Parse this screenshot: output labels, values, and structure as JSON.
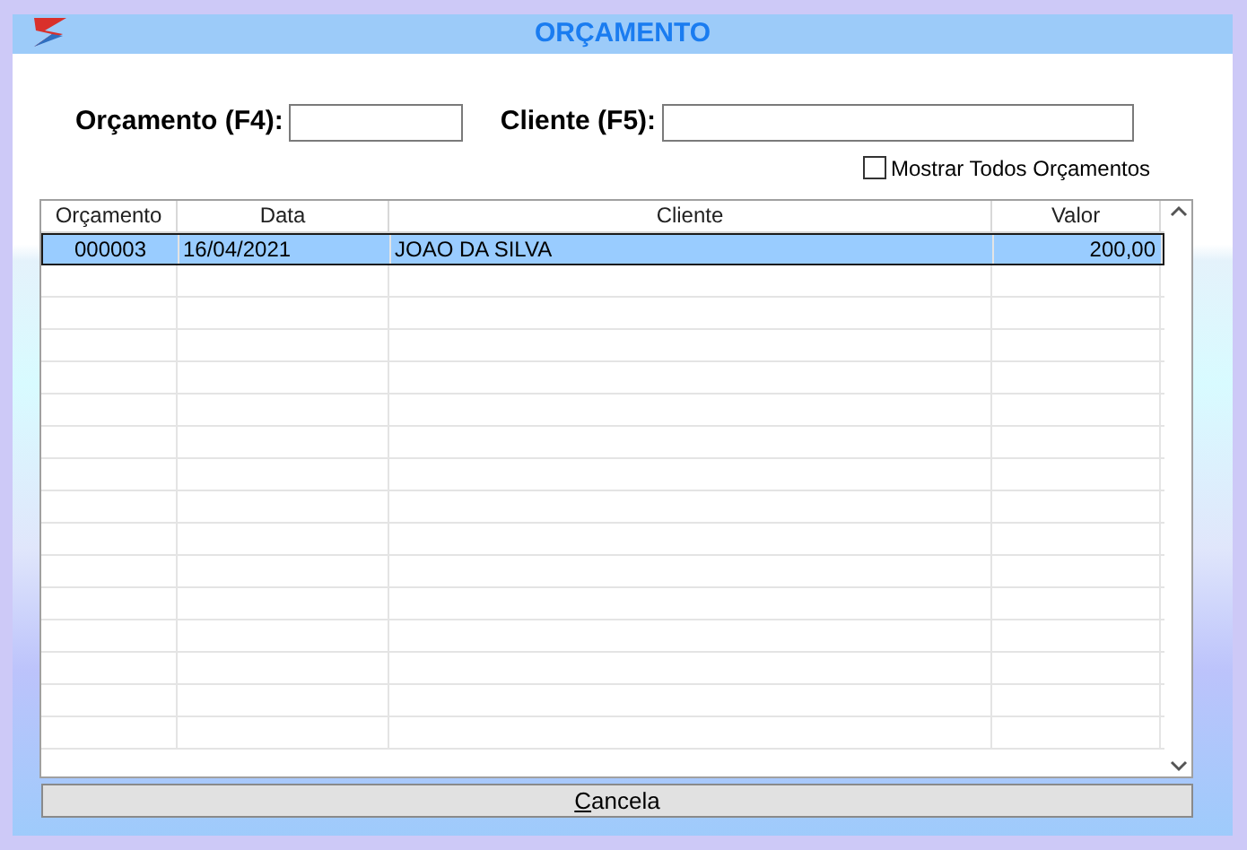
{
  "window": {
    "title": "ORÇAMENTO"
  },
  "filters": {
    "orcamento": {
      "label": "Orçamento (F4):"
    },
    "cliente": {
      "label": "Cliente (F5):"
    },
    "show_all": {
      "label": "Mostrar Todos Orçamentos",
      "checked": false
    }
  },
  "table": {
    "columns": [
      "Orçamento",
      "Data",
      "Cliente",
      "Valor"
    ],
    "rows": [
      {
        "cells": [
          "000003",
          "16/04/2021",
          "JOAO DA SILVA",
          "200,00"
        ],
        "selected": true
      }
    ]
  },
  "cancel_button": {
    "mnemonic": "C",
    "rest": "ancela"
  }
}
